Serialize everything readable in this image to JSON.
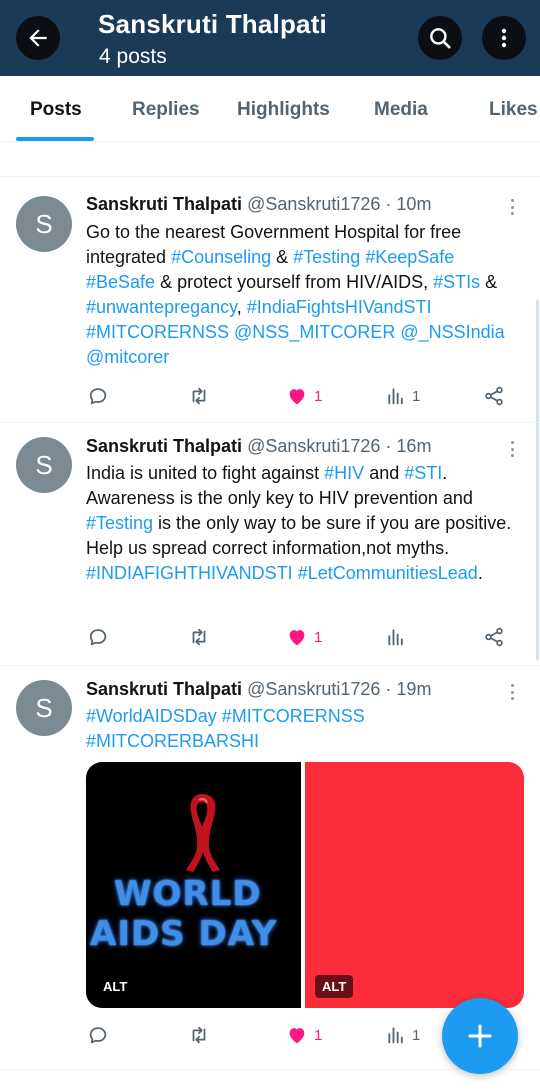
{
  "header": {
    "title": "Sanskruti Thalpati",
    "subtitle": "4 posts"
  },
  "tabs": [
    {
      "label": "Posts",
      "active": true
    },
    {
      "label": "Replies",
      "active": false
    },
    {
      "label": "Highlights",
      "active": false
    },
    {
      "label": "Media",
      "active": false
    },
    {
      "label": "Likes",
      "active": false
    }
  ],
  "tweets": [
    {
      "avatar_letter": "S",
      "name": "Sanskruti Thalpati",
      "handle": "@Sanskruti1726",
      "sep": " · ",
      "time": "10m",
      "segments": {
        "s1": "Go to the nearest Government Hospital for free integrated ",
        "s2": "#Counseling",
        "s3": " & ",
        "s4": "#Testing",
        "s5": " ",
        "s6": "#KeepSafe",
        "s7": " ",
        "s8": "#BeSafe",
        "s9": " & protect yourself from HIV/AIDS, ",
        "s10": "#STIs",
        "s11": " & ",
        "s12": "#unwantepregancy",
        "s13": ", ",
        "s14": "#IndiaFightsHIVandSTI",
        "s15": " ",
        "s16": "#MITCORERNSS",
        "s17": " ",
        "s18": "@NSS_MITCORER",
        "s19": " ",
        "s20": "@_NSSIndia",
        "s21": " ",
        "s22": "@mitcorer"
      },
      "likes": "1",
      "views": "1"
    },
    {
      "avatar_letter": "S",
      "name": "Sanskruti Thalpati",
      "handle": "@Sanskruti1726",
      "sep": " · ",
      "time": "16m",
      "segments": {
        "s1": "India is united to fight against ",
        "s2": "#HIV",
        "s3": " and ",
        "s4": "#STI",
        "s5": ". Awareness is the only key to HIV prevention and ",
        "s6": "#Testing",
        "s7": " is the only way to be sure if you are positive. Help us spread correct information,not myths. ",
        "s8": "#INDIAFIGHTHIVANDSTI",
        "s9": " ",
        "s10": "#LetCommunitiesLead",
        "s11": "."
      },
      "likes": "1",
      "views": ""
    },
    {
      "avatar_letter": "S",
      "name": "Sanskruti Thalpati",
      "handle": "@Sanskruti1726",
      "sep": " · ",
      "time": "19m",
      "segments": {
        "s1": "#WorldAIDSDay",
        "s2": " ",
        "s3": "#MITCORERNSS",
        "s4": " ",
        "s5": "#MITCORERBARSHI"
      },
      "media": {
        "left_line1": "WORLD",
        "left_line2": "AIDS DAY",
        "alt_label": "ALT"
      },
      "likes": "1",
      "views": "1"
    }
  ],
  "colors": {
    "header_bg": "#1b3a57",
    "accent": "#1d9bf0",
    "like": "#f91880",
    "muted": "#536471"
  },
  "icons": [
    "back-arrow-icon",
    "search-icon",
    "more-vertical-icon",
    "reply-icon",
    "retweet-icon",
    "heart-icon",
    "views-icon",
    "share-icon",
    "compose-plus-icon"
  ]
}
